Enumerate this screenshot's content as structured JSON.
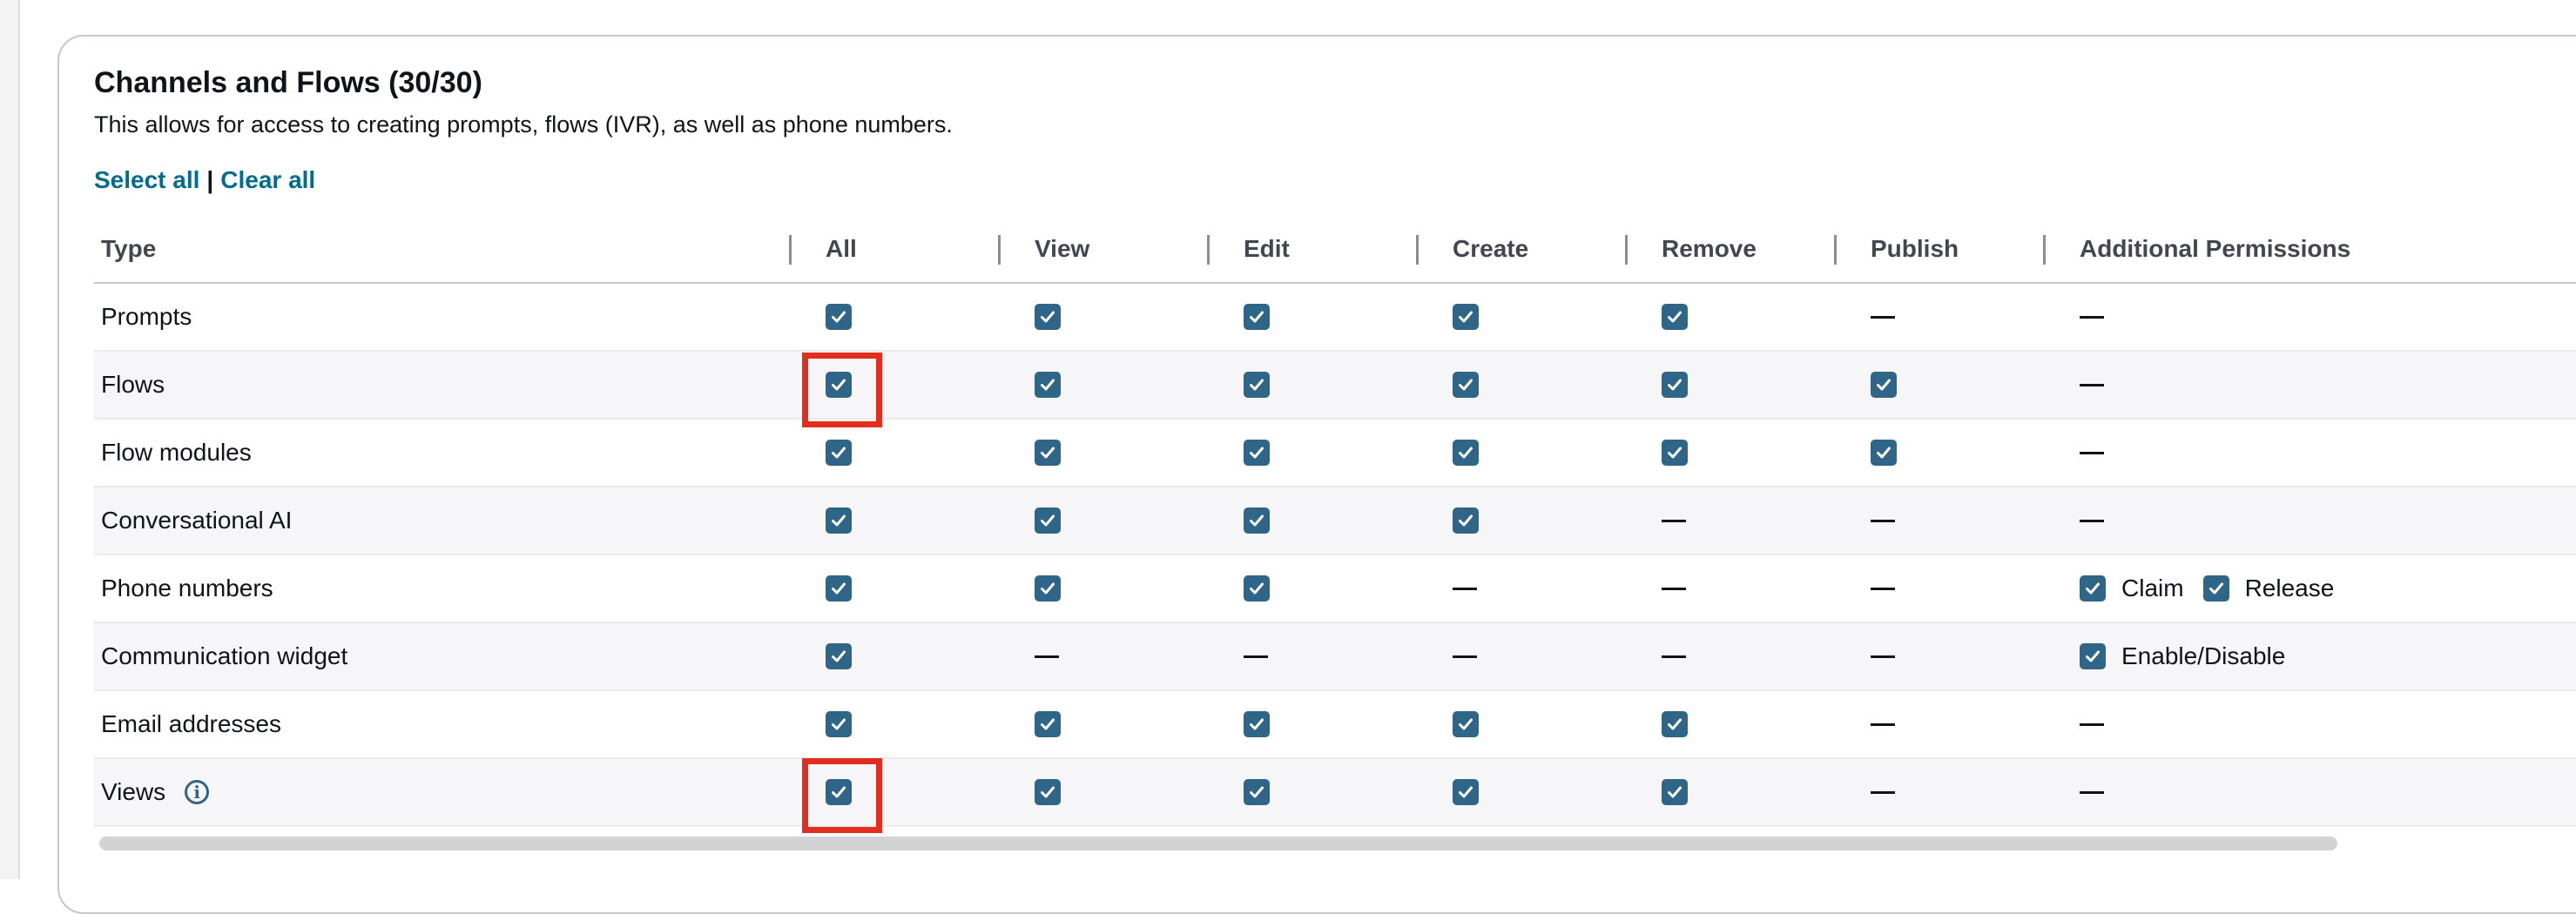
{
  "section": {
    "title": "Channels and Flows (30/30)",
    "description": "This allows for access to creating prompts, flows (IVR), as well as phone numbers.",
    "select_all_label": "Select all",
    "separator": "|",
    "clear_all_label": "Clear all"
  },
  "table": {
    "columns": [
      "Type",
      "All",
      "View",
      "Edit",
      "Create",
      "Remove",
      "Publish",
      "Additional Permissions"
    ],
    "rows": [
      {
        "type": "Prompts",
        "all": true,
        "view": true,
        "edit": true,
        "create": true,
        "remove": true,
        "publish": null,
        "additional": []
      },
      {
        "type": "Flows",
        "all": true,
        "view": true,
        "edit": true,
        "create": true,
        "remove": true,
        "publish": true,
        "additional": []
      },
      {
        "type": "Flow modules",
        "all": true,
        "view": true,
        "edit": true,
        "create": true,
        "remove": true,
        "publish": true,
        "additional": []
      },
      {
        "type": "Conversational AI",
        "all": true,
        "view": true,
        "edit": true,
        "create": true,
        "remove": null,
        "publish": null,
        "additional": []
      },
      {
        "type": "Phone numbers",
        "all": true,
        "view": true,
        "edit": true,
        "create": null,
        "remove": null,
        "publish": null,
        "additional": [
          {
            "label": "Claim",
            "checked": true
          },
          {
            "label": "Release",
            "checked": true
          }
        ]
      },
      {
        "type": "Communication widget",
        "all": true,
        "view": null,
        "edit": null,
        "create": null,
        "remove": null,
        "publish": null,
        "additional": [
          {
            "label": "Enable/Disable",
            "checked": true
          }
        ]
      },
      {
        "type": "Email addresses",
        "all": true,
        "view": true,
        "edit": true,
        "create": true,
        "remove": true,
        "publish": null,
        "additional": []
      },
      {
        "type": "Views",
        "all": true,
        "view": true,
        "edit": true,
        "create": true,
        "remove": true,
        "publish": null,
        "additional": [],
        "info_icon": true
      }
    ]
  },
  "colors": {
    "checkbox": "#2f6687",
    "link": "#006c8f",
    "highlight": "#e22d1f"
  }
}
